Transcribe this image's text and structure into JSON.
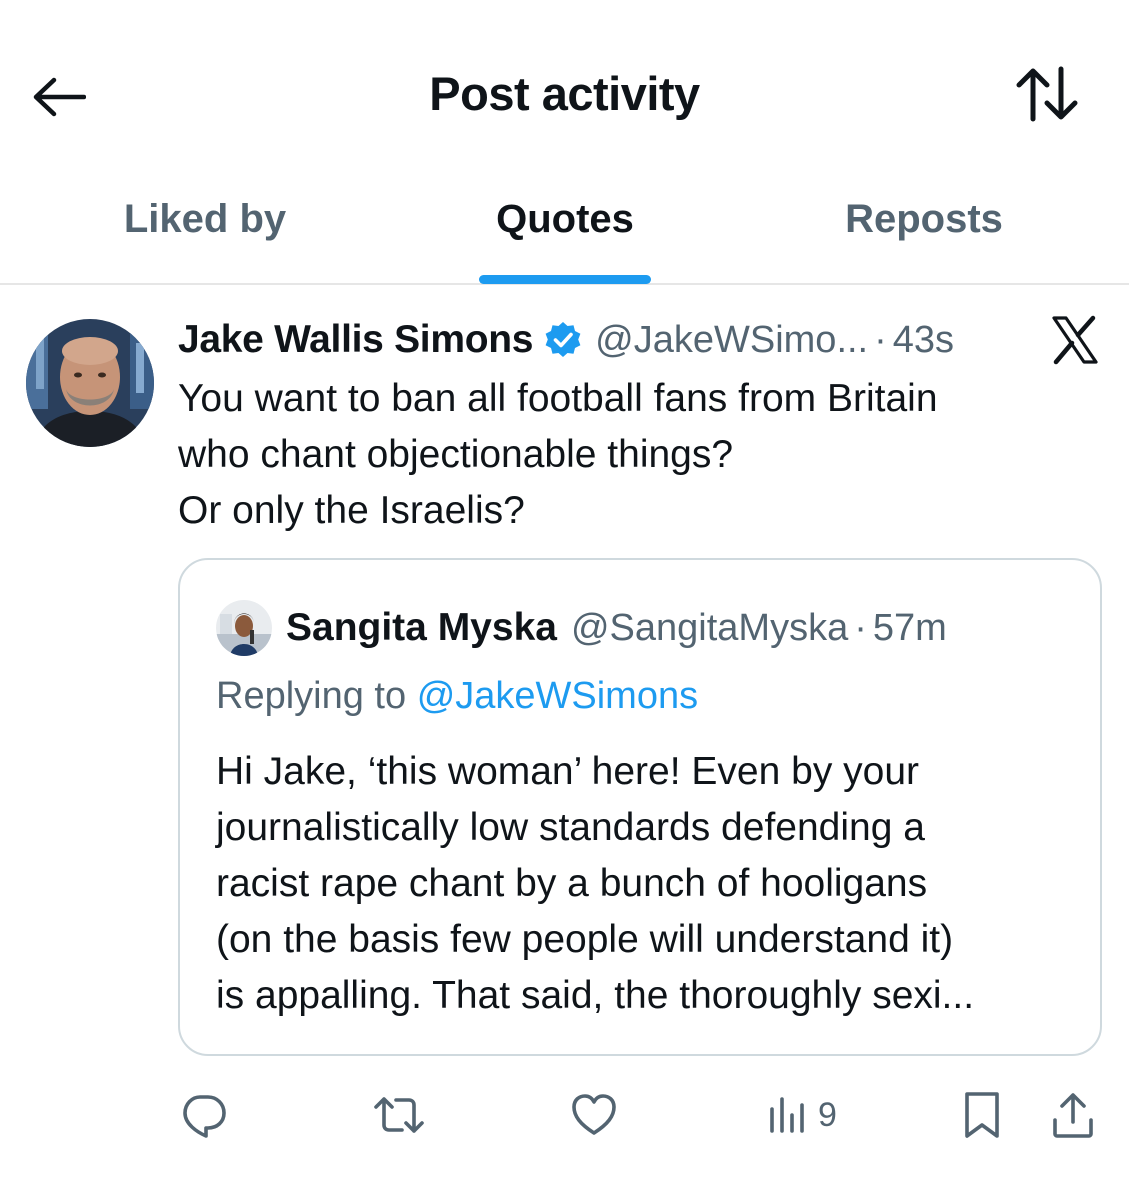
{
  "header": {
    "title": "Post activity",
    "back_icon": "arrow-left-icon",
    "sort_icon": "sort-arrows-icon"
  },
  "tabs": [
    {
      "label": "Liked by",
      "active": false
    },
    {
      "label": "Quotes",
      "active": true
    },
    {
      "label": "Reposts",
      "active": false
    }
  ],
  "post": {
    "author_name": "Jake Wallis Simons",
    "verified": true,
    "handle": "@JakeWSimo...",
    "separator": "·",
    "time": "43s",
    "text": "You want to ban all football fans from Britain\nwho chant objectionable things?\nOr only the Israelis?",
    "quoted": {
      "author_name": "Sangita Myska",
      "handle": "@SangitaMyska",
      "separator": "·",
      "time": "57m",
      "replying_prefix": "Replying to",
      "replying_to": "@JakeWSimons",
      "text": "Hi Jake, ‘this woman’ here!  Even by your\njournalistically low standards defending a\nracist rape chant by a bunch of hooligans\n(on the basis few people will understand it)\nis appalling. That said, the thoroughly sexi..."
    },
    "actions": {
      "reply": {
        "icon": "reply-icon"
      },
      "repost": {
        "icon": "repost-icon"
      },
      "like": {
        "icon": "heart-icon"
      },
      "views": {
        "icon": "views-icon",
        "count": "9"
      },
      "bookmark": {
        "icon": "bookmark-icon"
      },
      "share": {
        "icon": "share-icon"
      }
    }
  },
  "colors": {
    "accent": "#1d9bf0",
    "text": "#0f1419",
    "secondary": "#536471",
    "border": "#cfd9de"
  }
}
